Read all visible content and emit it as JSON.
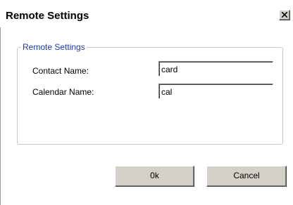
{
  "window": {
    "title": "Remote Settings",
    "close_icon": "close-icon"
  },
  "group": {
    "legend": "Remote Settings",
    "fields": [
      {
        "label": "Contact Name:",
        "value": "card"
      },
      {
        "label": "Calendar Name:",
        "value": "cal"
      }
    ]
  },
  "buttons": {
    "ok_label": "0k",
    "cancel_label": "Cancel"
  },
  "colors": {
    "legend_text": "#1d3aa8",
    "button_face": "#d4d0c8"
  }
}
